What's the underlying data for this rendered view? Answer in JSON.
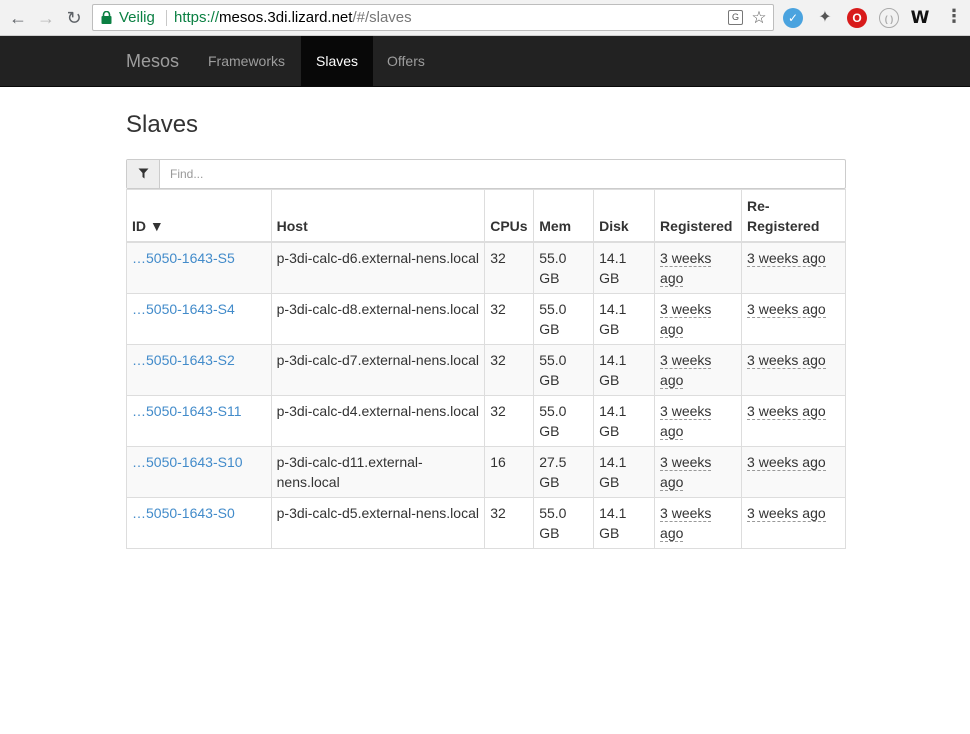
{
  "browser": {
    "secure_label": "Veilig",
    "url_scheme": "https://",
    "url_host": "mesos.3di.lizard.net",
    "url_path": "/#/slaves"
  },
  "navbar": {
    "brand": "Mesos",
    "links": [
      "Frameworks",
      "Slaves",
      "Offers"
    ],
    "active": "Slaves"
  },
  "page": {
    "title": "Slaves",
    "filter_placeholder": "Find..."
  },
  "table": {
    "headers": {
      "id": "ID ▼",
      "host": "Host",
      "cpus": "CPUs",
      "mem": "Mem",
      "disk": "Disk",
      "registered": "Registered",
      "reregistered": "Re-Registered"
    },
    "rows": [
      {
        "id": "…5050-1643-S5",
        "host": "p-3di-calc-d6.external-nens.local",
        "cpus": "32",
        "mem": "55.0 GB",
        "disk": "14.1 GB",
        "registered": "3 weeks ago",
        "reregistered": "3 weeks ago"
      },
      {
        "id": "…5050-1643-S4",
        "host": "p-3di-calc-d8.external-nens.local",
        "cpus": "32",
        "mem": "55.0 GB",
        "disk": "14.1 GB",
        "registered": "3 weeks ago",
        "reregistered": "3 weeks ago"
      },
      {
        "id": "…5050-1643-S2",
        "host": "p-3di-calc-d7.external-nens.local",
        "cpus": "32",
        "mem": "55.0 GB",
        "disk": "14.1 GB",
        "registered": "3 weeks ago",
        "reregistered": "3 weeks ago"
      },
      {
        "id": "…5050-1643-S11",
        "host": "p-3di-calc-d4.external-nens.local",
        "cpus": "32",
        "mem": "55.0 GB",
        "disk": "14.1 GB",
        "registered": "3 weeks ago",
        "reregistered": "3 weeks ago"
      },
      {
        "id": "…5050-1643-S10",
        "host": "p-3di-calc-d11.external-nens.local",
        "cpus": "16",
        "mem": "27.5 GB",
        "disk": "14.1 GB",
        "registered": "3 weeks ago",
        "reregistered": "3 weeks ago"
      },
      {
        "id": "…5050-1643-S0",
        "host": "p-3di-calc-d5.external-nens.local",
        "cpus": "32",
        "mem": "55.0 GB",
        "disk": "14.1 GB",
        "registered": "3 weeks ago",
        "reregistered": "3 weeks ago"
      }
    ]
  },
  "colors": {
    "navbar_bg": "#222222",
    "link": "#428bca",
    "secure": "#0b8043"
  }
}
